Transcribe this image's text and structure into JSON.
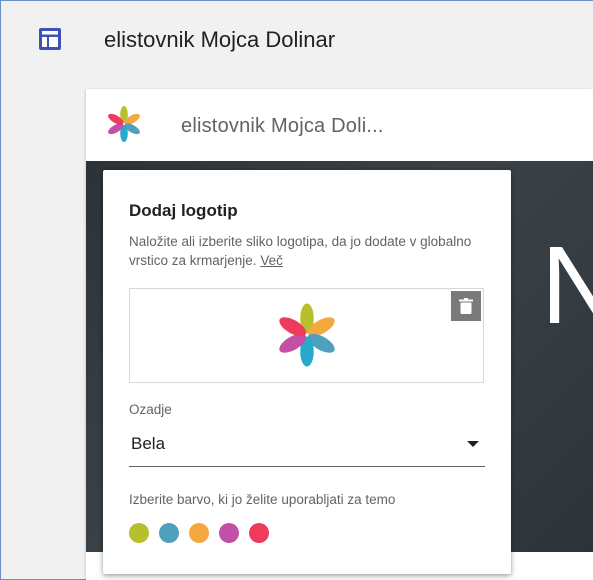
{
  "app": {
    "site_title": "elistovnik Mojca Dolinar",
    "site_icon": "site-layout-icon"
  },
  "canvas": {
    "header_title": "elistovnik Mojca Doli...",
    "logo_icon": "pinwheel-logo",
    "hero_text": "N"
  },
  "panel": {
    "title": "Dodaj logotip",
    "description": "Naložite ali izberite sliko logotipa, da jo dodate v globalno vrstico za krmarjenje.",
    "more_link": "Več",
    "delete_icon": "trash-icon",
    "background_label": "Ozadje",
    "background_value": "Bela",
    "color_label": "Izberite barvo, ki jo želite uporabljati za temo",
    "colors": [
      "#b8bf2c",
      "#4f9fbd",
      "#f4a940",
      "#c34fa6",
      "#ee3b5b"
    ]
  }
}
